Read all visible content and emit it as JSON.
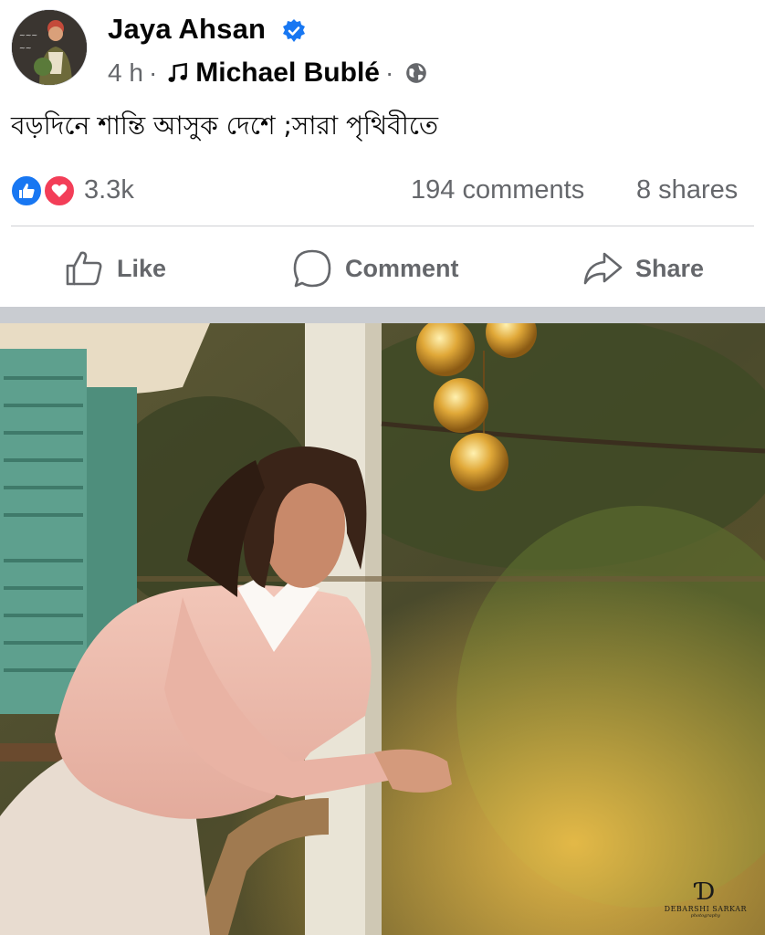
{
  "post": {
    "author": "Jaya Ahsan",
    "time": "4 h",
    "separator": "·",
    "song": "Michael Bublé",
    "privacy_icon": "globe-icon",
    "caption": "বড়দিনে শান্তি আসুক দেশে ;সারা পৃথিবীতে"
  },
  "stats": {
    "reactions": "3.3k",
    "comments": "194 comments",
    "shares": "8 shares"
  },
  "actions": {
    "like": "Like",
    "comment": "Comment",
    "share": "Share"
  },
  "image": {
    "credit_mark": "Ɗ",
    "credit_name": "DEBARSHI SARKAR",
    "credit_sub": "photography"
  },
  "colors": {
    "brand_blue": "#1877f2",
    "love_red": "#f33e58",
    "secondary_text": "#65676b"
  }
}
